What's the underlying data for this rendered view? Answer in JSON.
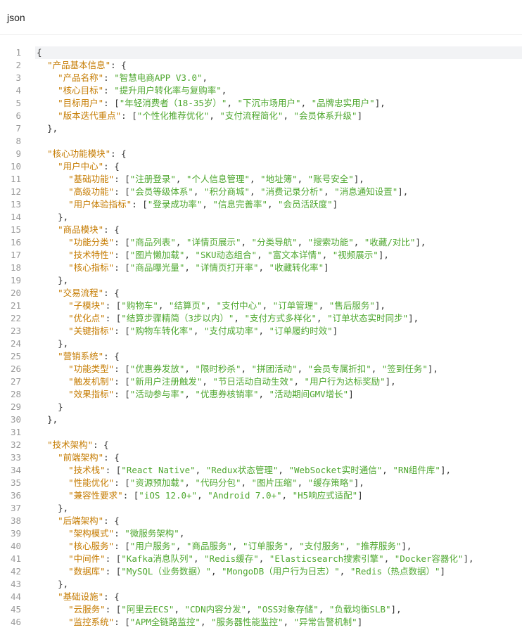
{
  "header": {
    "title": "json"
  },
  "active_line": 1,
  "lines": [
    [
      [
        "p",
        "{"
      ]
    ],
    [
      [
        "i",
        1
      ],
      [
        "k",
        "\"产品基本信息\""
      ],
      [
        "p",
        ": {"
      ]
    ],
    [
      [
        "i",
        2
      ],
      [
        "k",
        "\"产品名称\""
      ],
      [
        "p",
        ": "
      ],
      [
        "s",
        "\"智慧电商APP V3.0\""
      ],
      [
        "p",
        ","
      ]
    ],
    [
      [
        "i",
        2
      ],
      [
        "k",
        "\"核心目标\""
      ],
      [
        "p",
        ": "
      ],
      [
        "s",
        "\"提升用户转化率与复购率\""
      ],
      [
        "p",
        ","
      ]
    ],
    [
      [
        "i",
        2
      ],
      [
        "k",
        "\"目标用户\""
      ],
      [
        "p",
        ": ["
      ],
      [
        "s",
        "\"年轻消费者（18-35岁）\""
      ],
      [
        "p",
        ", "
      ],
      [
        "s",
        "\"下沉市场用户\""
      ],
      [
        "p",
        ", "
      ],
      [
        "s",
        "\"品牌忠实用户\""
      ],
      [
        "p",
        "],"
      ]
    ],
    [
      [
        "i",
        2
      ],
      [
        "k",
        "\"版本迭代重点\""
      ],
      [
        "p",
        ": ["
      ],
      [
        "s",
        "\"个性化推荐优化\""
      ],
      [
        "p",
        ", "
      ],
      [
        "s",
        "\"支付流程简化\""
      ],
      [
        "p",
        ", "
      ],
      [
        "s",
        "\"会员体系升级\""
      ],
      [
        "p",
        "]"
      ]
    ],
    [
      [
        "i",
        1
      ],
      [
        "p",
        "},"
      ]
    ],
    [],
    [
      [
        "i",
        1
      ],
      [
        "k",
        "\"核心功能模块\""
      ],
      [
        "p",
        ": {"
      ]
    ],
    [
      [
        "i",
        2
      ],
      [
        "k",
        "\"用户中心\""
      ],
      [
        "p",
        ": {"
      ]
    ],
    [
      [
        "i",
        3
      ],
      [
        "k",
        "\"基础功能\""
      ],
      [
        "p",
        ": ["
      ],
      [
        "s",
        "\"注册登录\""
      ],
      [
        "p",
        ", "
      ],
      [
        "s",
        "\"个人信息管理\""
      ],
      [
        "p",
        ", "
      ],
      [
        "s",
        "\"地址簿\""
      ],
      [
        "p",
        ", "
      ],
      [
        "s",
        "\"账号安全\""
      ],
      [
        "p",
        "],"
      ]
    ],
    [
      [
        "i",
        3
      ],
      [
        "k",
        "\"高级功能\""
      ],
      [
        "p",
        ": ["
      ],
      [
        "s",
        "\"会员等级体系\""
      ],
      [
        "p",
        ", "
      ],
      [
        "s",
        "\"积分商城\""
      ],
      [
        "p",
        ", "
      ],
      [
        "s",
        "\"消费记录分析\""
      ],
      [
        "p",
        ", "
      ],
      [
        "s",
        "\"消息通知设置\""
      ],
      [
        "p",
        "],"
      ]
    ],
    [
      [
        "i",
        3
      ],
      [
        "k",
        "\"用户体验指标\""
      ],
      [
        "p",
        ": ["
      ],
      [
        "s",
        "\"登录成功率\""
      ],
      [
        "p",
        ", "
      ],
      [
        "s",
        "\"信息完善率\""
      ],
      [
        "p",
        ", "
      ],
      [
        "s",
        "\"会员活跃度\""
      ],
      [
        "p",
        "]"
      ]
    ],
    [
      [
        "i",
        2
      ],
      [
        "p",
        "},"
      ]
    ],
    [
      [
        "i",
        2
      ],
      [
        "k",
        "\"商品模块\""
      ],
      [
        "p",
        ": {"
      ]
    ],
    [
      [
        "i",
        3
      ],
      [
        "k",
        "\"功能分类\""
      ],
      [
        "p",
        ": ["
      ],
      [
        "s",
        "\"商品列表\""
      ],
      [
        "p",
        ", "
      ],
      [
        "s",
        "\"详情页展示\""
      ],
      [
        "p",
        ", "
      ],
      [
        "s",
        "\"分类导航\""
      ],
      [
        "p",
        ", "
      ],
      [
        "s",
        "\"搜索功能\""
      ],
      [
        "p",
        ", "
      ],
      [
        "s",
        "\"收藏/对比\""
      ],
      [
        "p",
        "],"
      ]
    ],
    [
      [
        "i",
        3
      ],
      [
        "k",
        "\"技术特性\""
      ],
      [
        "p",
        ": ["
      ],
      [
        "s",
        "\"图片懒加载\""
      ],
      [
        "p",
        ", "
      ],
      [
        "s",
        "\"SKU动态组合\""
      ],
      [
        "p",
        ", "
      ],
      [
        "s",
        "\"富文本详情\""
      ],
      [
        "p",
        ", "
      ],
      [
        "s",
        "\"视频展示\""
      ],
      [
        "p",
        "],"
      ]
    ],
    [
      [
        "i",
        3
      ],
      [
        "k",
        "\"核心指标\""
      ],
      [
        "p",
        ": ["
      ],
      [
        "s",
        "\"商品曝光量\""
      ],
      [
        "p",
        ", "
      ],
      [
        "s",
        "\"详情页打开率\""
      ],
      [
        "p",
        ", "
      ],
      [
        "s",
        "\"收藏转化率\""
      ],
      [
        "p",
        "]"
      ]
    ],
    [
      [
        "i",
        2
      ],
      [
        "p",
        "},"
      ]
    ],
    [
      [
        "i",
        2
      ],
      [
        "k",
        "\"交易流程\""
      ],
      [
        "p",
        ": {"
      ]
    ],
    [
      [
        "i",
        3
      ],
      [
        "k",
        "\"子模块\""
      ],
      [
        "p",
        ": ["
      ],
      [
        "s",
        "\"购物车\""
      ],
      [
        "p",
        ", "
      ],
      [
        "s",
        "\"结算页\""
      ],
      [
        "p",
        ", "
      ],
      [
        "s",
        "\"支付中心\""
      ],
      [
        "p",
        ", "
      ],
      [
        "s",
        "\"订单管理\""
      ],
      [
        "p",
        ", "
      ],
      [
        "s",
        "\"售后服务\""
      ],
      [
        "p",
        "],"
      ]
    ],
    [
      [
        "i",
        3
      ],
      [
        "k",
        "\"优化点\""
      ],
      [
        "p",
        ": ["
      ],
      [
        "s",
        "\"结算步骤精简（3步以内）\""
      ],
      [
        "p",
        ", "
      ],
      [
        "s",
        "\"支付方式多样化\""
      ],
      [
        "p",
        ", "
      ],
      [
        "s",
        "\"订单状态实时同步\""
      ],
      [
        "p",
        "],"
      ]
    ],
    [
      [
        "i",
        3
      ],
      [
        "k",
        "\"关键指标\""
      ],
      [
        "p",
        ": ["
      ],
      [
        "s",
        "\"购物车转化率\""
      ],
      [
        "p",
        ", "
      ],
      [
        "s",
        "\"支付成功率\""
      ],
      [
        "p",
        ", "
      ],
      [
        "s",
        "\"订单履约时效\""
      ],
      [
        "p",
        "]"
      ]
    ],
    [
      [
        "i",
        2
      ],
      [
        "p",
        "},"
      ]
    ],
    [
      [
        "i",
        2
      ],
      [
        "k",
        "\"营销系统\""
      ],
      [
        "p",
        ": {"
      ]
    ],
    [
      [
        "i",
        3
      ],
      [
        "k",
        "\"功能类型\""
      ],
      [
        "p",
        ": ["
      ],
      [
        "s",
        "\"优惠券发放\""
      ],
      [
        "p",
        ", "
      ],
      [
        "s",
        "\"限时秒杀\""
      ],
      [
        "p",
        ", "
      ],
      [
        "s",
        "\"拼团活动\""
      ],
      [
        "p",
        ", "
      ],
      [
        "s",
        "\"会员专属折扣\""
      ],
      [
        "p",
        ", "
      ],
      [
        "s",
        "\"签到任务\""
      ],
      [
        "p",
        "],"
      ]
    ],
    [
      [
        "i",
        3
      ],
      [
        "k",
        "\"触发机制\""
      ],
      [
        "p",
        ": ["
      ],
      [
        "s",
        "\"新用户注册触发\""
      ],
      [
        "p",
        ", "
      ],
      [
        "s",
        "\"节日活动自动生效\""
      ],
      [
        "p",
        ", "
      ],
      [
        "s",
        "\"用户行为达标奖励\""
      ],
      [
        "p",
        "],"
      ]
    ],
    [
      [
        "i",
        3
      ],
      [
        "k",
        "\"效果指标\""
      ],
      [
        "p",
        ": ["
      ],
      [
        "s",
        "\"活动参与率\""
      ],
      [
        "p",
        ", "
      ],
      [
        "s",
        "\"优惠券核销率\""
      ],
      [
        "p",
        ", "
      ],
      [
        "s",
        "\"活动期间GMV增长\""
      ],
      [
        "p",
        "]"
      ]
    ],
    [
      [
        "i",
        2
      ],
      [
        "p",
        "}"
      ]
    ],
    [
      [
        "i",
        1
      ],
      [
        "p",
        "},"
      ]
    ],
    [],
    [
      [
        "i",
        1
      ],
      [
        "k",
        "\"技术架构\""
      ],
      [
        "p",
        ": {"
      ]
    ],
    [
      [
        "i",
        2
      ],
      [
        "k",
        "\"前端架构\""
      ],
      [
        "p",
        ": {"
      ]
    ],
    [
      [
        "i",
        3
      ],
      [
        "k",
        "\"技术栈\""
      ],
      [
        "p",
        ": ["
      ],
      [
        "s",
        "\"React Native\""
      ],
      [
        "p",
        ", "
      ],
      [
        "s",
        "\"Redux状态管理\""
      ],
      [
        "p",
        ", "
      ],
      [
        "s",
        "\"WebSocket实时通信\""
      ],
      [
        "p",
        ", "
      ],
      [
        "s",
        "\"RN组件库\""
      ],
      [
        "p",
        "],"
      ]
    ],
    [
      [
        "i",
        3
      ],
      [
        "k",
        "\"性能优化\""
      ],
      [
        "p",
        ": ["
      ],
      [
        "s",
        "\"资源预加载\""
      ],
      [
        "p",
        ", "
      ],
      [
        "s",
        "\"代码分包\""
      ],
      [
        "p",
        ", "
      ],
      [
        "s",
        "\"图片压缩\""
      ],
      [
        "p",
        ", "
      ],
      [
        "s",
        "\"缓存策略\""
      ],
      [
        "p",
        "],"
      ]
    ],
    [
      [
        "i",
        3
      ],
      [
        "k",
        "\"兼容性要求\""
      ],
      [
        "p",
        ": ["
      ],
      [
        "s",
        "\"iOS 12.0+\""
      ],
      [
        "p",
        ", "
      ],
      [
        "s",
        "\"Android 7.0+\""
      ],
      [
        "p",
        ", "
      ],
      [
        "s",
        "\"H5响应式适配\""
      ],
      [
        "p",
        "]"
      ]
    ],
    [
      [
        "i",
        2
      ],
      [
        "p",
        "},"
      ]
    ],
    [
      [
        "i",
        2
      ],
      [
        "k",
        "\"后端架构\""
      ],
      [
        "p",
        ": {"
      ]
    ],
    [
      [
        "i",
        3
      ],
      [
        "k",
        "\"架构模式\""
      ],
      [
        "p",
        ": "
      ],
      [
        "s",
        "\"微服务架构\""
      ],
      [
        "p",
        ","
      ]
    ],
    [
      [
        "i",
        3
      ],
      [
        "k",
        "\"核心服务\""
      ],
      [
        "p",
        ": ["
      ],
      [
        "s",
        "\"用户服务\""
      ],
      [
        "p",
        ", "
      ],
      [
        "s",
        "\"商品服务\""
      ],
      [
        "p",
        ", "
      ],
      [
        "s",
        "\"订单服务\""
      ],
      [
        "p",
        ", "
      ],
      [
        "s",
        "\"支付服务\""
      ],
      [
        "p",
        ", "
      ],
      [
        "s",
        "\"推荐服务\""
      ],
      [
        "p",
        "],"
      ]
    ],
    [
      [
        "i",
        3
      ],
      [
        "k",
        "\"中间件\""
      ],
      [
        "p",
        ": ["
      ],
      [
        "s",
        "\"Kafka消息队列\""
      ],
      [
        "p",
        ", "
      ],
      [
        "s",
        "\"Redis缓存\""
      ],
      [
        "p",
        ", "
      ],
      [
        "s",
        "\"Elasticsearch搜索引擎\""
      ],
      [
        "p",
        ", "
      ],
      [
        "s",
        "\"Docker容器化\""
      ],
      [
        "p",
        "],"
      ]
    ],
    [
      [
        "i",
        3
      ],
      [
        "k",
        "\"数据库\""
      ],
      [
        "p",
        ": ["
      ],
      [
        "s",
        "\"MySQL（业务数据）\""
      ],
      [
        "p",
        ", "
      ],
      [
        "s",
        "\"MongoDB（用户行为日志）\""
      ],
      [
        "p",
        ", "
      ],
      [
        "s",
        "\"Redis（热点数据）\""
      ],
      [
        "p",
        "]"
      ]
    ],
    [
      [
        "i",
        2
      ],
      [
        "p",
        "},"
      ]
    ],
    [
      [
        "i",
        2
      ],
      [
        "k",
        "\"基础设施\""
      ],
      [
        "p",
        ": {"
      ]
    ],
    [
      [
        "i",
        3
      ],
      [
        "k",
        "\"云服务\""
      ],
      [
        "p",
        ": ["
      ],
      [
        "s",
        "\"阿里云ECS\""
      ],
      [
        "p",
        ", "
      ],
      [
        "s",
        "\"CDN内容分发\""
      ],
      [
        "p",
        ", "
      ],
      [
        "s",
        "\"OSS对象存储\""
      ],
      [
        "p",
        ", "
      ],
      [
        "s",
        "\"负载均衡SLB\""
      ],
      [
        "p",
        "],"
      ]
    ],
    [
      [
        "i",
        3
      ],
      [
        "k",
        "\"监控系统\""
      ],
      [
        "p",
        ": ["
      ],
      [
        "s",
        "\"APM全链路监控\""
      ],
      [
        "p",
        ", "
      ],
      [
        "s",
        "\"服务器性能监控\""
      ],
      [
        "p",
        ", "
      ],
      [
        "s",
        "\"异常告警机制\""
      ],
      [
        "p",
        "]"
      ]
    ]
  ]
}
